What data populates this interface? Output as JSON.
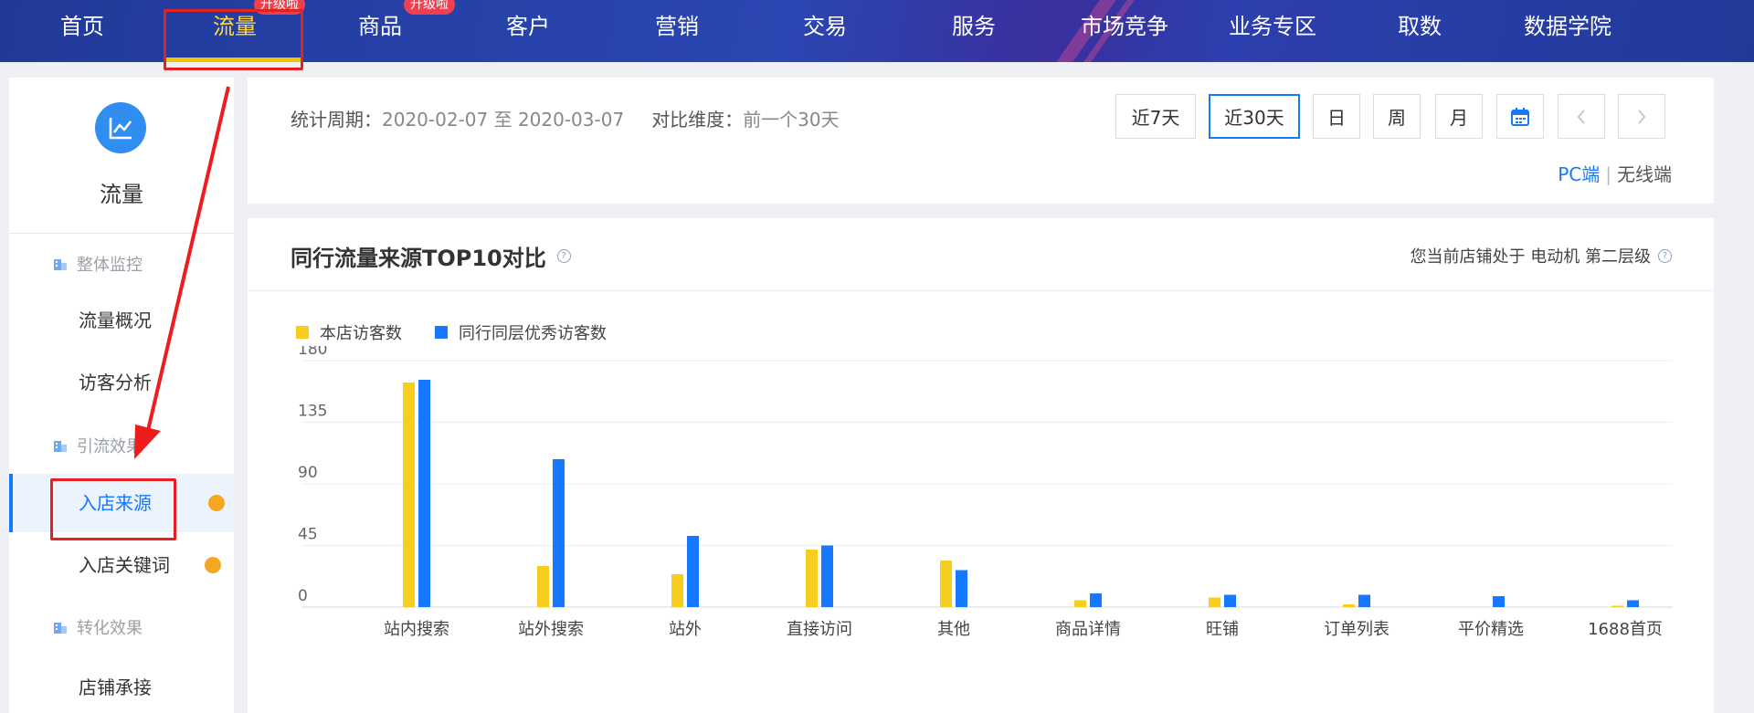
{
  "topnav": {
    "items": [
      "首页",
      "流量",
      "商品",
      "客户",
      "营销",
      "交易",
      "服务",
      "市场竞争",
      "业务专区",
      "取数",
      "数据学院"
    ],
    "active_index": 1,
    "badges": {
      "traffic": "升级啦",
      "goods": "升级啦"
    }
  },
  "sidebar": {
    "title": "流量",
    "groups": [
      "整体监控",
      "引流效果",
      "转化效果"
    ],
    "items": [
      "流量概况",
      "访客分析",
      "入店来源",
      "入店关键词",
      "店铺承接"
    ],
    "active_item": "入店来源"
  },
  "filter": {
    "period_label": "统计周期：",
    "period_value": "2020-02-07 至 2020-03-07",
    "compare_label": "对比维度：",
    "compare_value": "前一个30天",
    "buttons": [
      "近7天",
      "近30天",
      "日",
      "周",
      "月"
    ],
    "active_button": "近30天",
    "device_pc": "PC端",
    "device_separator": "|",
    "device_mobile": "无线端"
  },
  "panel": {
    "title": "同行流量来源TOP10对比",
    "right_text": "您当前店铺处于 电动机 第二层级"
  },
  "colors": {
    "own": "#f5ce1e",
    "peer": "#1677ff",
    "accent": "#1677ff",
    "nav_active": "#ffd83a"
  },
  "chart_data": {
    "type": "bar",
    "categories": [
      "站内搜索",
      "站外搜索",
      "站外",
      "直接访问",
      "其他",
      "商品详情",
      "旺铺",
      "订单列表",
      "平价精选",
      "1688首页"
    ],
    "series": [
      {
        "name": "本店访客数",
        "values": [
          164,
          30,
          24,
          42,
          34,
          5,
          7,
          2,
          0,
          1
        ]
      },
      {
        "name": "同行同层优秀访客数",
        "values": [
          166,
          108,
          52,
          45,
          27,
          10,
          9,
          9,
          8,
          5
        ]
      }
    ],
    "yticks": [
      "180",
      "135",
      "90",
      "45",
      "0"
    ],
    "ylim": [
      0,
      180
    ],
    "grid": true,
    "legend_position": "top-left"
  }
}
